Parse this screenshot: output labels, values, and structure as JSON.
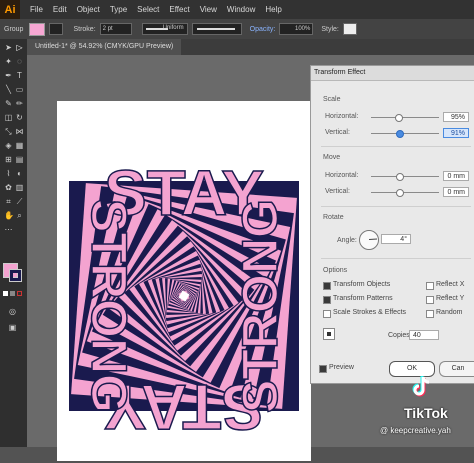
{
  "app": {
    "logo": "Ai",
    "menus": [
      "File",
      "Edit",
      "Object",
      "Type",
      "Select",
      "Effect",
      "View",
      "Window",
      "Help"
    ]
  },
  "control_bar": {
    "group_label": "Group",
    "stroke_label": "Stroke:",
    "stroke_value": "2 pt",
    "stroke_profile": "Uniform",
    "opacity_label": "Opacity:",
    "opacity_value": "100%",
    "style_label": "Style:"
  },
  "document": {
    "tab_title": "Untitled-1* @ 54.92% (CMYK/GPU Preview)"
  },
  "artwork": {
    "word_1": "STAY",
    "word_2": "STRONG",
    "fill_color": "#f4a3d0",
    "stroke_color": "#1a1a4e"
  },
  "dialog": {
    "title": "Transform Effect",
    "scale": {
      "label": "Scale",
      "horizontal_label": "Horizontal:",
      "horizontal_value": "95%",
      "vertical_label": "Vertical:",
      "vertical_value": "91%"
    },
    "move": {
      "label": "Move",
      "horizontal_label": "Horizontal:",
      "horizontal_value": "0 mm",
      "vertical_label": "Vertical:",
      "vertical_value": "0 mm"
    },
    "rotate": {
      "label": "Rotate",
      "angle_label": "Angle:",
      "angle_value": "4°"
    },
    "options": {
      "label": "Options",
      "transform_objects": "Transform Objects",
      "transform_patterns": "Transform Patterns",
      "scale_strokes": "Scale Strokes & Effects",
      "reflect_x": "Reflect X",
      "reflect_y": "Reflect Y",
      "random": "Random"
    },
    "copies_label": "Copies",
    "copies_value": "40",
    "preview_label": "Preview",
    "ok_label": "OK",
    "cancel_label": "Can"
  },
  "watermark": {
    "brand": "TikTok",
    "handle": "@ keepcreative.yah"
  }
}
